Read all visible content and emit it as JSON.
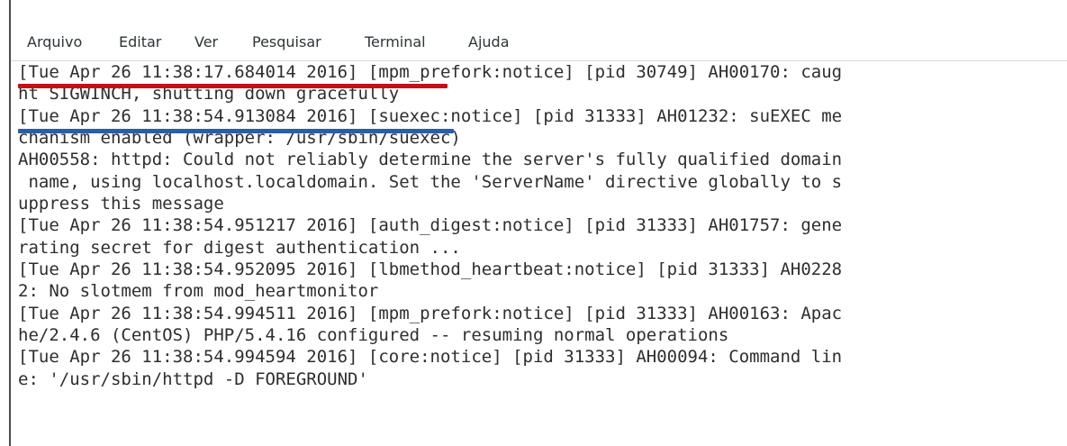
{
  "menu": {
    "items": [
      "Arquivo",
      "Editar",
      "Ver",
      "Pesquisar",
      "Terminal",
      "Ajuda"
    ]
  },
  "terminal": {
    "lines": [
      "[Tue Apr 26 11:38:17.684014 2016] [mpm_prefork:notice] [pid 30749] AH00170: caug",
      "ht SIGWINCH, shutting down gracefully",
      "[Tue Apr 26 11:38:54.913084 2016] [suexec:notice] [pid 31333] AH01232: suEXEC me",
      "chanism enabled (wrapper: /usr/sbin/suexec)",
      "AH00558: httpd: Could not reliably determine the server's fully qualified domain",
      " name, using localhost.localdomain. Set the 'ServerName' directive globally to s",
      "uppress this message",
      "[Tue Apr 26 11:38:54.951217 2016] [auth_digest:notice] [pid 31333] AH01757: gene",
      "rating secret for digest authentication ...",
      "[Tue Apr 26 11:38:54.952095 2016] [lbmethod_heartbeat:notice] [pid 31333] AH0228",
      "2: No slotmem from mod_heartmonitor",
      "[Tue Apr 26 11:38:54.994511 2016] [mpm_prefork:notice] [pid 31333] AH00163: Apac",
      "he/2.4.6 (CentOS) PHP/5.4.16 configured -- resuming normal operations",
      "[Tue Apr 26 11:38:54.994594 2016] [core:notice] [pid 31333] AH00094: Command lin",
      "e: '/usr/sbin/httpd -D FOREGROUND'"
    ]
  },
  "annotations": {
    "red_color": "#c41212",
    "blue_color": "#2b5da8"
  }
}
